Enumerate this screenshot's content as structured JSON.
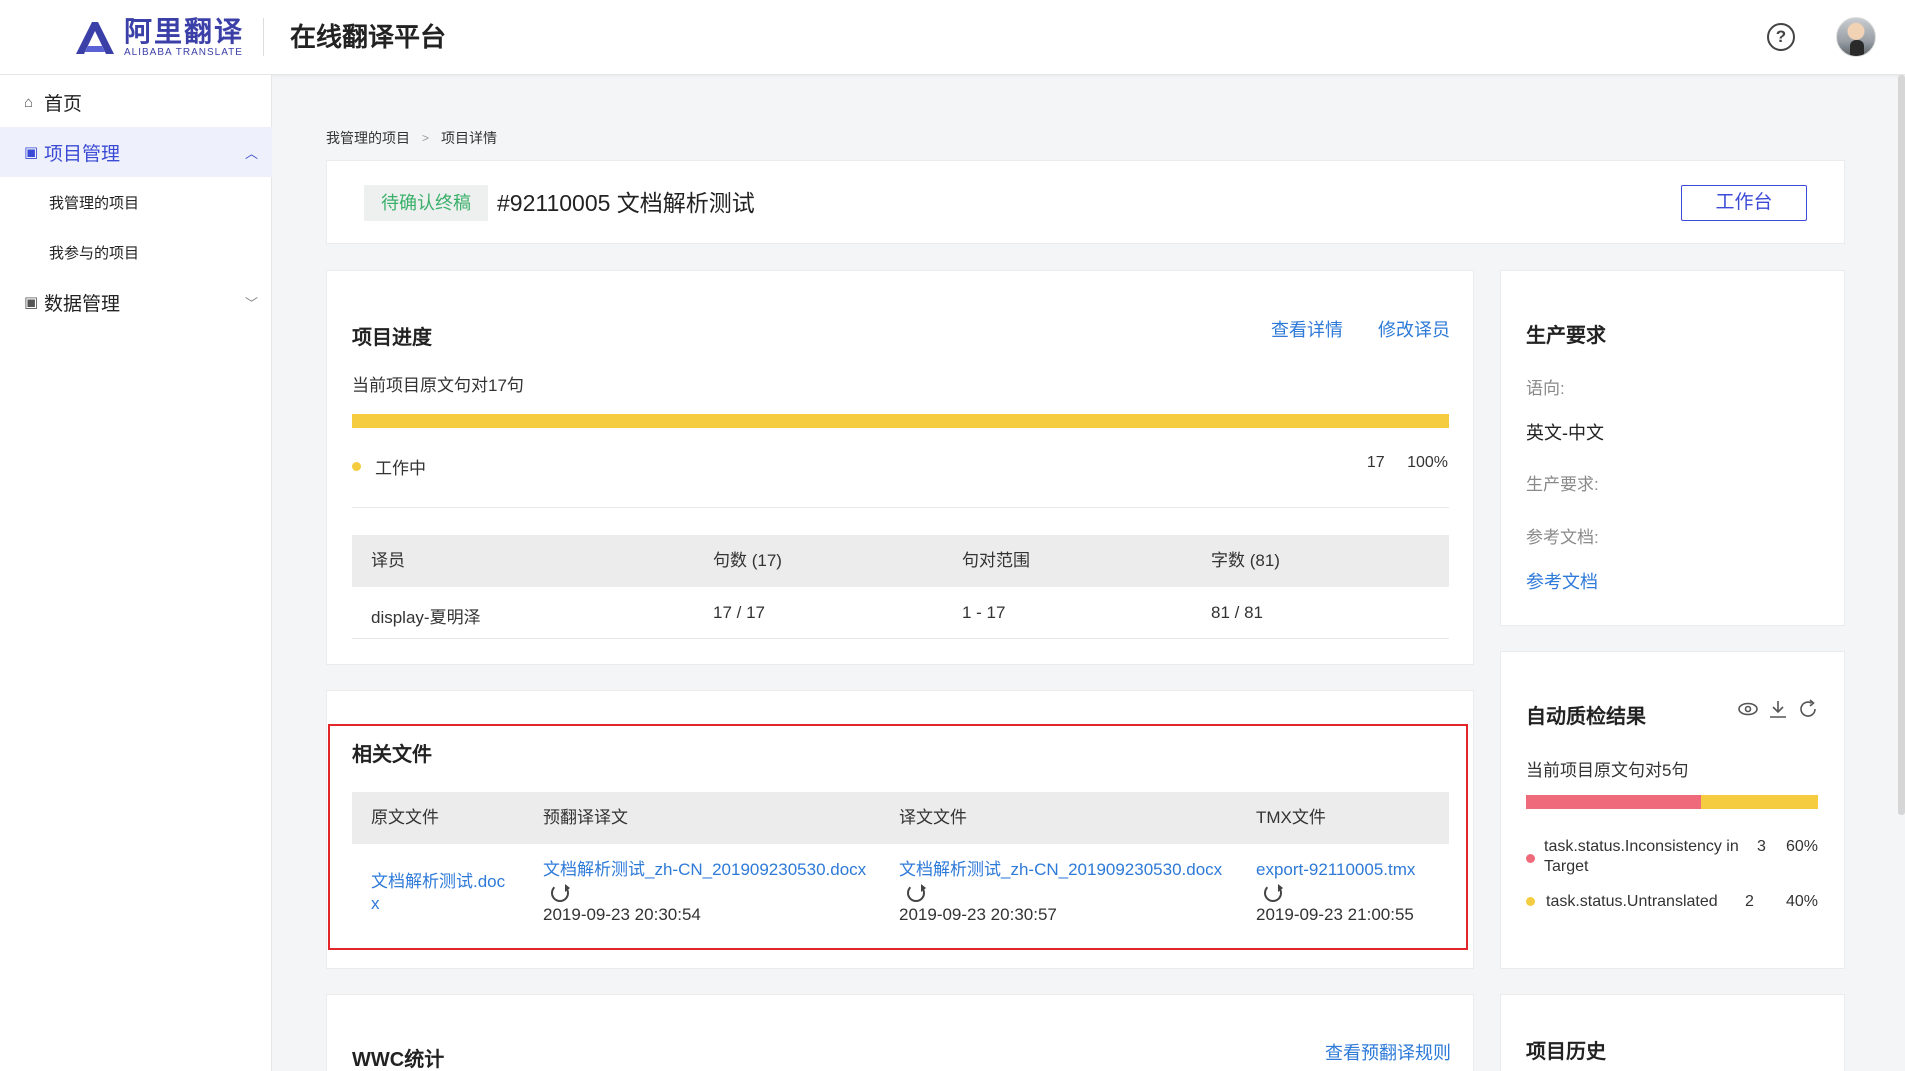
{
  "header": {
    "logo_cn": "阿里翻译",
    "logo_en": "ALIBABA TRANSLATE",
    "platform_title": "在线翻译平台",
    "help_icon": "help-circle-icon"
  },
  "sidebar": {
    "items": [
      {
        "label": "首页",
        "icon": "home-icon"
      },
      {
        "label": "项目管理",
        "icon": "image-icon",
        "expanded": true
      },
      {
        "label": "我管理的项目"
      },
      {
        "label": "我参与的项目"
      },
      {
        "label": "数据管理",
        "icon": "image-icon",
        "expanded": false
      }
    ]
  },
  "breadcrumb": {
    "parent": "我管理的项目",
    "current": "项目详情"
  },
  "project": {
    "status": "待确认终稿",
    "title": "#92110005 文档解析测试",
    "workbench_label": "工作台"
  },
  "progress": {
    "title": "项目进度",
    "view_details": "查看详情",
    "edit_translator": "修改译员",
    "subtitle": "当前项目原文句对17句",
    "percent": 100,
    "status_label": "工作中",
    "status_count": "17",
    "status_percent": "100%",
    "table": {
      "headers": [
        "译员",
        "句数 (17)",
        "句对范围",
        "字数 (81)"
      ],
      "rows": [
        [
          "display-夏明泽",
          "17 / 17",
          "1 - 17",
          "81 / 81"
        ]
      ]
    }
  },
  "files": {
    "title": "相关文件",
    "headers": [
      "原文文件",
      "预翻译译文",
      "译文文件",
      "TMX文件"
    ],
    "row": {
      "source": "文档解析测试.docx",
      "pretranslated": "文档解析测试_zh-CN_201909230530.docx",
      "pretranslated_date": "2019-09-23 20:30:54",
      "translated": "文档解析测试_zh-CN_201909230530.docx",
      "translated_date": "2019-09-23 20:30:57",
      "tmx": "export-92110005.tmx",
      "tmx_date": "2019-09-23 21:00:55"
    }
  },
  "wwc": {
    "title": "WWC统计",
    "rules_link": "查看预翻译规则"
  },
  "requirements": {
    "title": "生产要求",
    "direction_label": "语向:",
    "direction_value": "英文-中文",
    "production_label": "生产要求:",
    "ref_label": "参考文档:",
    "ref_link": "参考文档"
  },
  "qa": {
    "title": "自动质检结果",
    "subtitle": "当前项目原文句对5句",
    "items": [
      {
        "label": "task.status.Inconsistency in Target",
        "count": "3",
        "percent": "60%",
        "share": 60
      },
      {
        "label": "task.status.Untranslated",
        "count": "2",
        "percent": "40%",
        "share": 40
      }
    ]
  },
  "history": {
    "title": "项目历史"
  },
  "colors": {
    "accent": "#3b4bd6",
    "link": "#2e7ad8",
    "progress_yellow": "#f5cc3f",
    "qa_red": "#ef6a7a",
    "status_green": "#3bb06a",
    "highlight_red": "#e3262a"
  }
}
